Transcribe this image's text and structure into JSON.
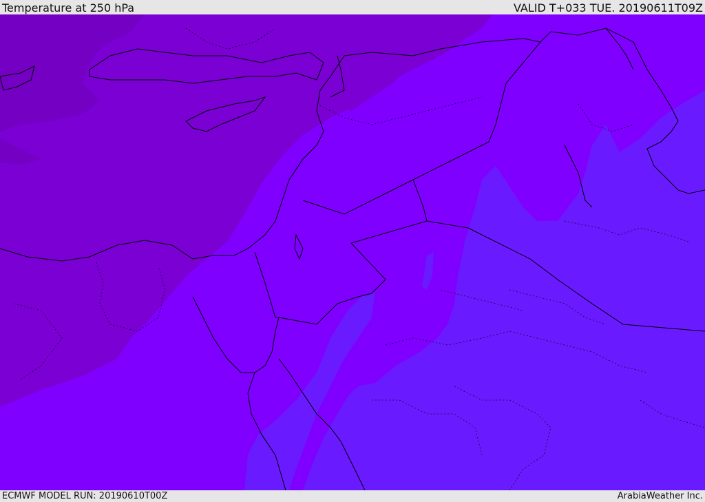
{
  "header": {
    "title": "Temperature at 250 hPa",
    "valid_time": "VALID T+033 TUE. 20190611T09Z"
  },
  "footer": {
    "model_run": "ECMWF MODEL RUN: 20190610T00Z",
    "credit": "ArabiaWeather Inc."
  },
  "map": {
    "field": "temperature",
    "level_hpa": 250,
    "colors": {
      "darkest": "#7b00cc",
      "dark": "#7a00d4",
      "mid": "#7f00ff",
      "light": "#6a1aff",
      "border": "#000000"
    }
  }
}
